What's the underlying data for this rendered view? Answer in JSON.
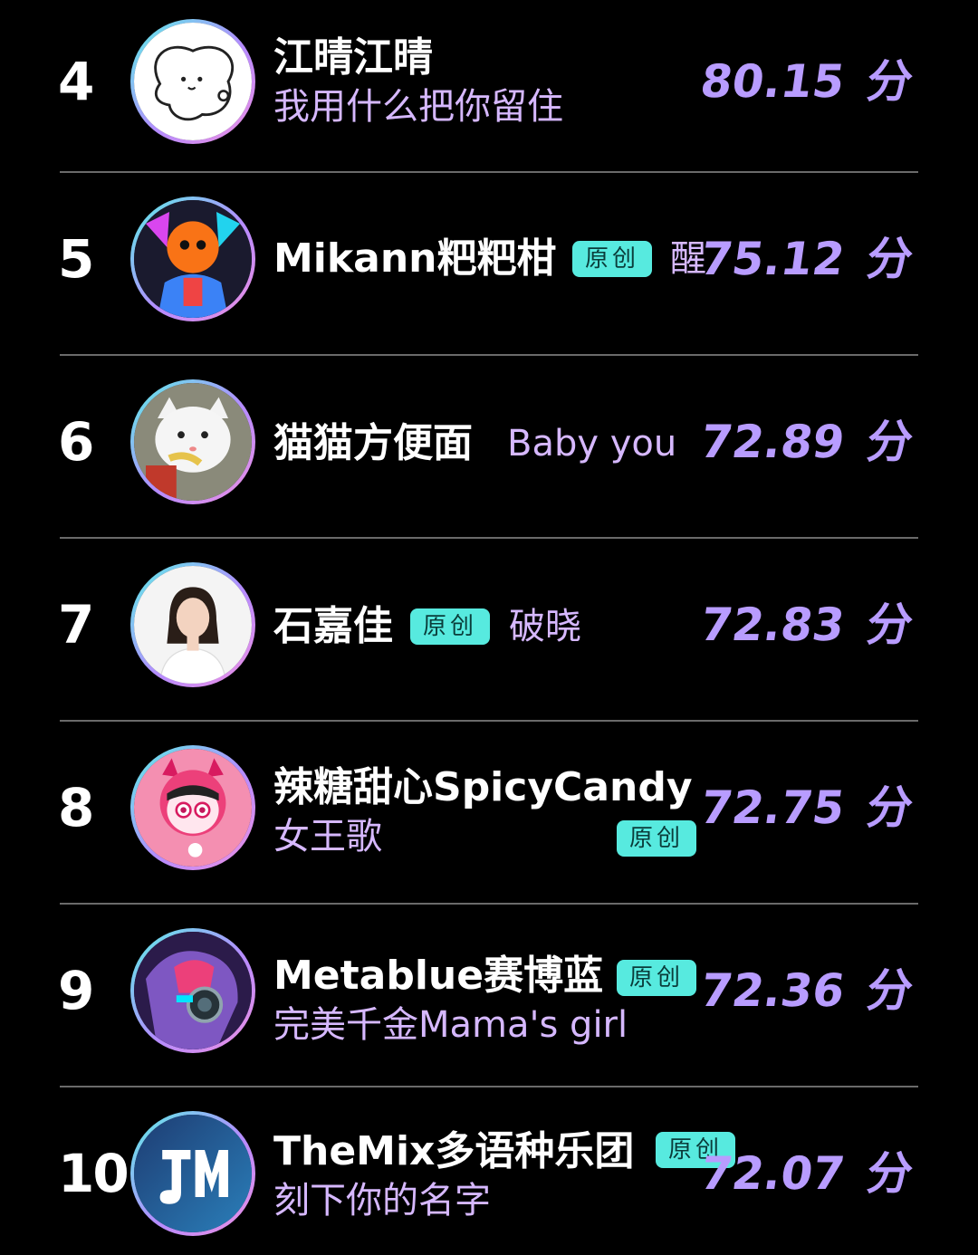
{
  "badge_label": "原创",
  "score_unit": "分",
  "entries": [
    {
      "rank": "4",
      "name": "江晴江晴",
      "song": "我用什么把你留住",
      "score": "80.15",
      "badge": false
    },
    {
      "rank": "5",
      "name": "Mikann粑粑柑",
      "song": "醒",
      "score": "75.12",
      "badge": true
    },
    {
      "rank": "6",
      "name": "猫猫方便面",
      "song": "Baby you",
      "score": "72.89",
      "badge": false
    },
    {
      "rank": "7",
      "name": "石嘉佳",
      "song": "破晓",
      "score": "72.83",
      "badge": true
    },
    {
      "rank": "8",
      "name": "辣糖甜心SpicyCandy",
      "song": "女王歌",
      "score": "72.75",
      "badge": true
    },
    {
      "rank": "9",
      "name": "Metablue赛博蓝",
      "song": "完美千金Mama's girl",
      "score": "72.36",
      "badge": true
    },
    {
      "rank": "10",
      "name": "TheMix多语种乐团",
      "song": "刻下你的名字",
      "score": "72.07",
      "badge": true
    }
  ],
  "colors": {
    "background": "#000000",
    "score": "#b89cff",
    "song": "#d6b8ff",
    "badge_bg": "#57eadf",
    "badge_text": "#0a3c3a",
    "divider": "#6a6a6a"
  },
  "icons": {
    "avatar_4": "cartoon-bunny-avatar",
    "avatar_5": "anime-character-avatar",
    "avatar_6": "white-cat-avatar",
    "avatar_7": "woman-portrait-avatar",
    "avatar_8": "pink-devil-avatar",
    "avatar_9": "cyber-character-avatar",
    "avatar_10": "themix-logo-avatar"
  }
}
